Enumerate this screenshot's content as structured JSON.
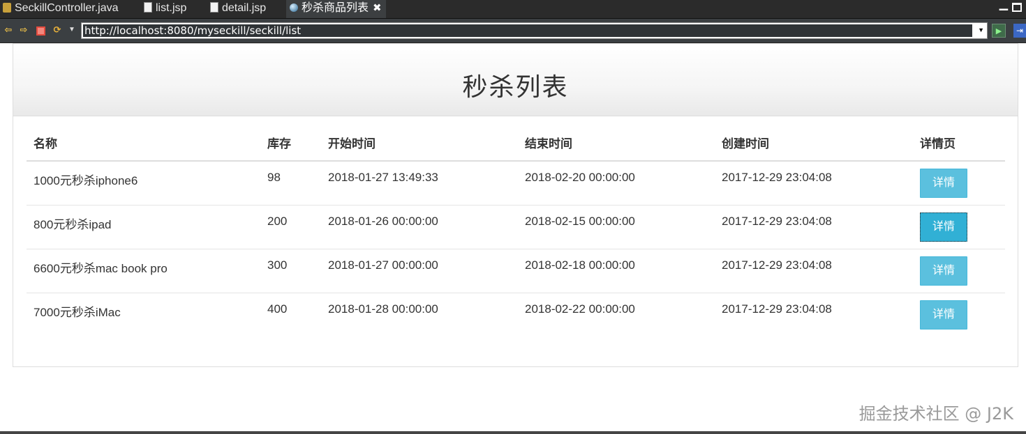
{
  "ide_tabs": [
    {
      "label": "SeckillController.java",
      "icon": "java-file-icon"
    },
    {
      "label": "list.jsp",
      "icon": "jsp-file-icon"
    },
    {
      "label": "detail.jsp",
      "icon": "jsp-file-icon"
    },
    {
      "label": "秒杀商品列表",
      "icon": "globe-icon",
      "active": true
    }
  ],
  "tab_close_glyph": "✖",
  "window": {
    "minimize_glyph": "▁"
  },
  "browser": {
    "url": "http://localhost:8080/myseckill/seckill/list",
    "back_glyph": "⇦",
    "forward_glyph": "⇨",
    "refresh_glyph": "⟳",
    "dropdown_glyph": "▼",
    "go_glyph": "▶",
    "ext_glyph": "⇥"
  },
  "page": {
    "title": "秒杀列表",
    "columns": [
      "名称",
      "库存",
      "开始时间",
      "结束时间",
      "创建时间",
      "详情页"
    ],
    "rows": [
      {
        "name": "1000元秒杀iphone6",
        "stock": "98",
        "start": "2018-01-27 13:49:33",
        "end": "2018-02-20 00:00:00",
        "created": "2017-12-29 23:04:08",
        "detail_label": "详情"
      },
      {
        "name": "800元秒杀ipad",
        "stock": "200",
        "start": "2018-01-26 00:00:00",
        "end": "2018-02-15 00:00:00",
        "created": "2017-12-29 23:04:08",
        "detail_label": "详情"
      },
      {
        "name": "6600元秒杀mac book pro",
        "stock": "300",
        "start": "2018-01-27 00:00:00",
        "end": "2018-02-18 00:00:00",
        "created": "2017-12-29 23:04:08",
        "detail_label": "详情"
      },
      {
        "name": "7000元秒杀iMac",
        "stock": "400",
        "start": "2018-01-28 00:00:00",
        "end": "2018-02-22 00:00:00",
        "created": "2017-12-29 23:04:08",
        "detail_label": "详情"
      }
    ]
  },
  "watermark": "掘金技术社区 @ J2K",
  "colors": {
    "button_info": "#5bc0de",
    "button_info_focused": "#31b0d5",
    "ide_background": "#2b2b2b"
  }
}
